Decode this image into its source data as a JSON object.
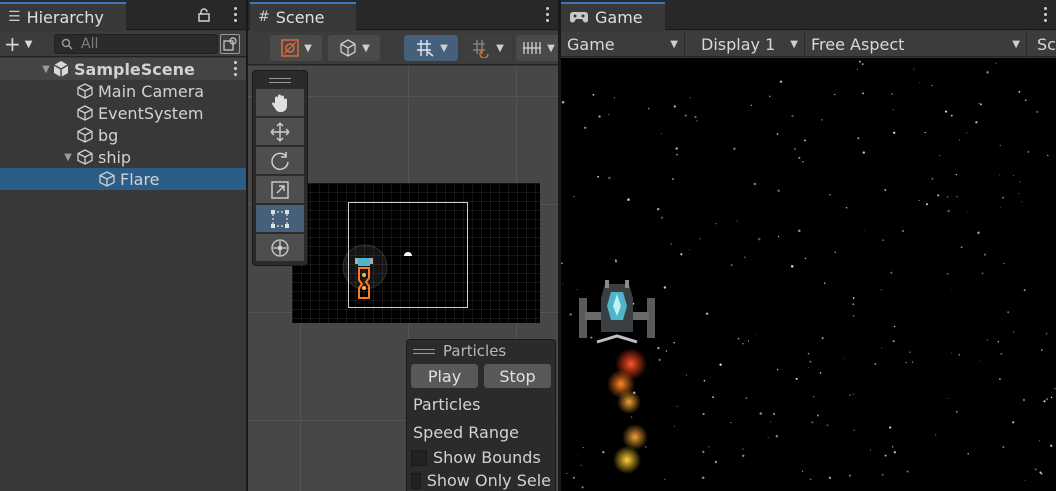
{
  "hierarchy": {
    "tab_label": "Hierarchy",
    "search_placeholder": "All",
    "scene_name": "SampleScene",
    "items": [
      {
        "label": "Main Camera"
      },
      {
        "label": "EventSystem"
      },
      {
        "label": "bg"
      },
      {
        "label": "ship"
      },
      {
        "label": "Flare"
      }
    ]
  },
  "scene": {
    "tab_label": "Scene",
    "particles_overlay": {
      "title": "Particles",
      "play_label": "Play",
      "stop_label": "Stop",
      "subtitle": "Particles",
      "speed_range_label": "Speed Range",
      "show_bounds_label": "Show Bounds",
      "show_only_selected_label": "Show Only Sele"
    }
  },
  "game": {
    "tab_label": "Game",
    "display_mode": "Game",
    "display": "Display 1",
    "aspect": "Free Aspect",
    "scale_label": "Sc"
  },
  "colors": {
    "panel_bg": "#383838",
    "tab_bar_bg": "#282828",
    "selection": "#2c5d87",
    "tab_accent": "#3a79bb",
    "ship_teal": "#4fb6c9",
    "flare_orange": "#ff7a1a"
  }
}
